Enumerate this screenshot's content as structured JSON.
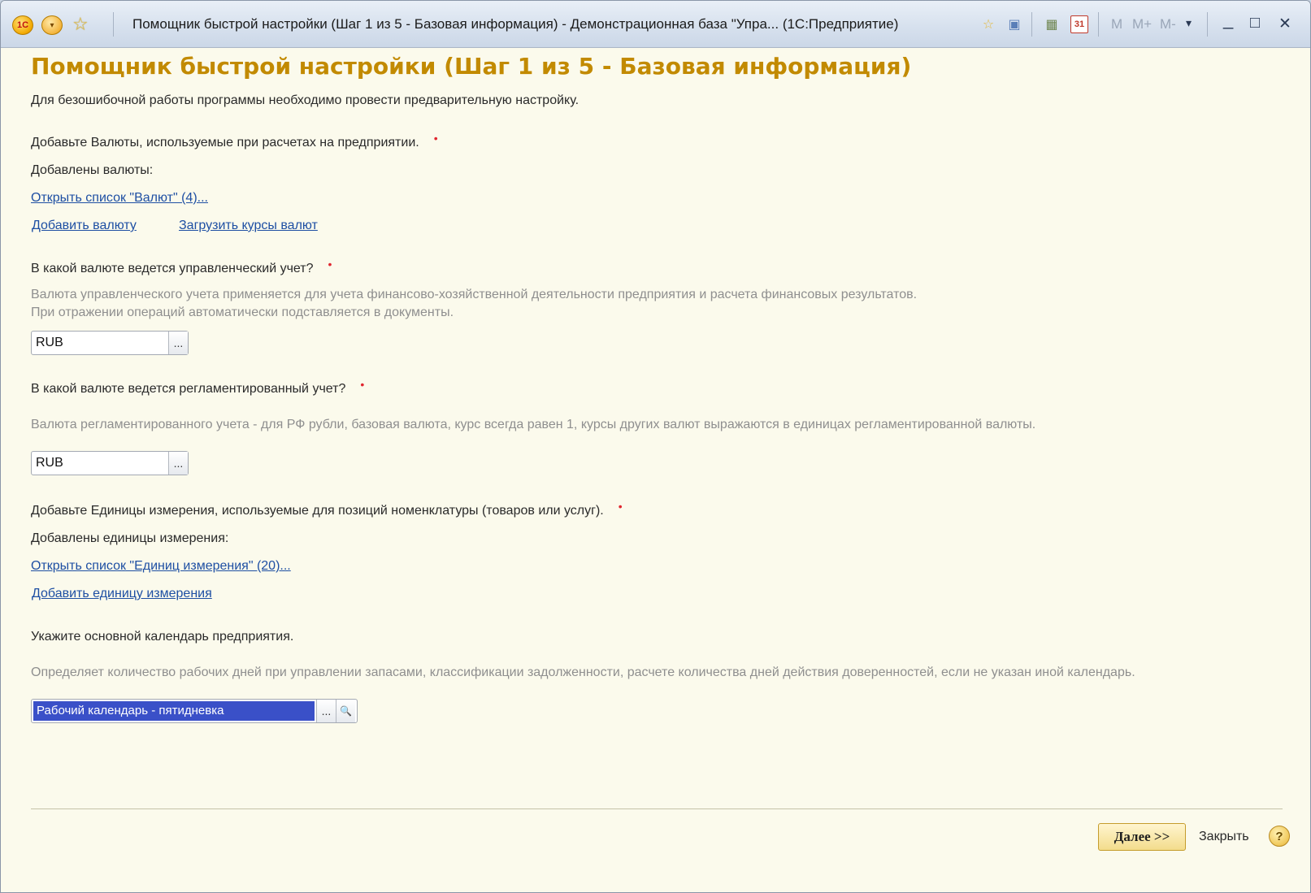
{
  "titlebar": {
    "logo_text": "1С",
    "title": "Помощник быстрой настройки (Шаг 1 из 5 - Базовая информация) - Демонстрационная база \"Упра... (1С:Предприятие)",
    "calc_m": "M",
    "calc_mplus": "M+",
    "calc_mminus": "M-",
    "min_glyph": "_",
    "max_glyph": "□",
    "close_glyph": "✕",
    "calendar_day": "31"
  },
  "page": {
    "heading": "Помощник быстрой настройки (Шаг 1 из 5 - Базовая информация)",
    "intro": "Для безошибочной работы программы необходимо провести предварительную настройку."
  },
  "currencies": {
    "prompt": "Добавьте Валюты, используемые при расчетах на предприятии.",
    "required_mark": "•",
    "added_label": "Добавлены валюты:",
    "open_list_link": "Открыть список \"Валют\" (4)...",
    "add_link": "Добавить валюту",
    "load_rates_link": "Загрузить курсы валют"
  },
  "mgmt_currency": {
    "question": "В какой валюте ведется управленческий учет?",
    "required_mark": "•",
    "hint_line1": "Валюта управленческого учета применяется для учета финансово-хозяйственной деятельности предприятия и расчета финансовых результатов.",
    "hint_line2": "При отражении операций автоматически подставляется в документы.",
    "value": "RUB",
    "select_glyph": "..."
  },
  "reg_currency": {
    "question": "В какой валюте ведется регламентированный учет?",
    "required_mark": "•",
    "hint": "Валюта регламентированного учета - для РФ рубли, базовая валюта, курс всегда равен 1, курсы других валют выражаются в единицах регламентированной валюты.",
    "value": "RUB",
    "select_glyph": "..."
  },
  "units": {
    "prompt": "Добавьте Единицы измерения, используемые для позиций номенклатуры (товаров или услуг).",
    "required_mark": "•",
    "added_label": "Добавлены единицы измерения:",
    "open_list_link": "Открыть список \"Единиц измерения\" (20)...",
    "add_link": "Добавить единицу измерения"
  },
  "calendar": {
    "prompt": "Укажите основной календарь предприятия.",
    "hint": "Определяет количество рабочих дней при управлении запасами, классификации задолженности, расчете количества дней действия доверенностей, если не указан иной календарь.",
    "value": "Рабочий календарь - пятидневка",
    "select_glyph": "...",
    "search_glyph": "🔍"
  },
  "footer": {
    "next_label": "Далее >>",
    "close_label": "Закрыть",
    "help_label": "?"
  },
  "colors": {
    "heading": "#c28a00",
    "link": "#1e4fa3",
    "required": "#e0262f",
    "hint": "#8f8f8f",
    "window_bg": "#fbfaec",
    "selection": "#3a50c8"
  }
}
